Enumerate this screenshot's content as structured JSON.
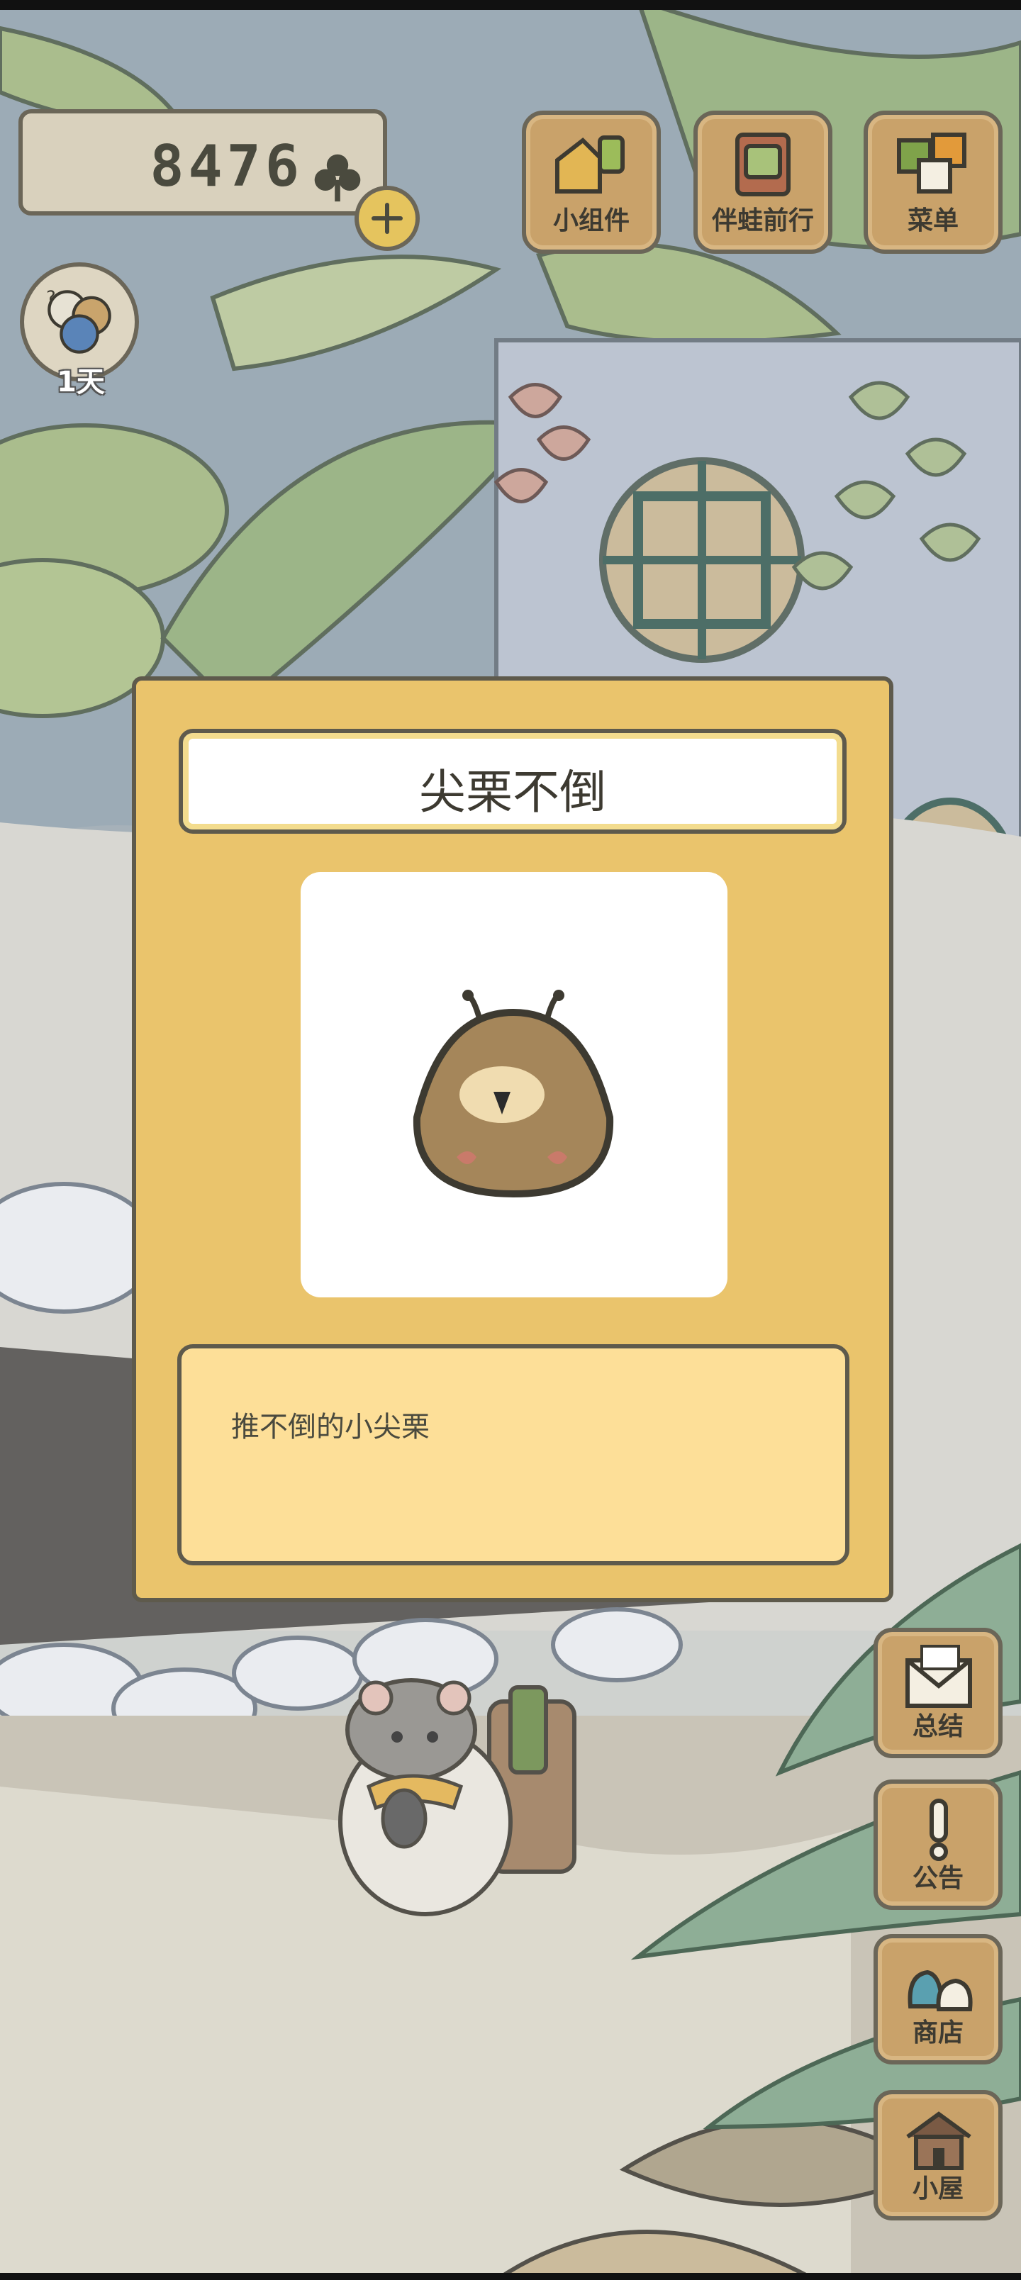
{
  "hud": {
    "currency_value": "8476",
    "currency_icon": "clover-icon",
    "day_label": "1天"
  },
  "top_buttons": [
    {
      "label": "小组件",
      "icon": "widget-icon"
    },
    {
      "label": "伴蛙前行",
      "icon": "travel-icon"
    },
    {
      "label": "菜单",
      "icon": "menu-icon"
    }
  ],
  "dialog": {
    "title": "尖栗不倒",
    "description": "推不倒的小尖栗",
    "item_icon": "chestnut-doll-icon"
  },
  "side_buttons": [
    {
      "label": "总结",
      "icon": "letter-icon"
    },
    {
      "label": "公告",
      "icon": "exclamation-icon"
    },
    {
      "label": "商店",
      "icon": "shop-bag-icon"
    },
    {
      "label": "小屋",
      "icon": "house-icon"
    }
  ],
  "colors": {
    "dialog_bg": "#eac46c",
    "desc_bg": "#fddf98",
    "wood_button": "#c9a26a",
    "outline": "#5e5a4c"
  }
}
